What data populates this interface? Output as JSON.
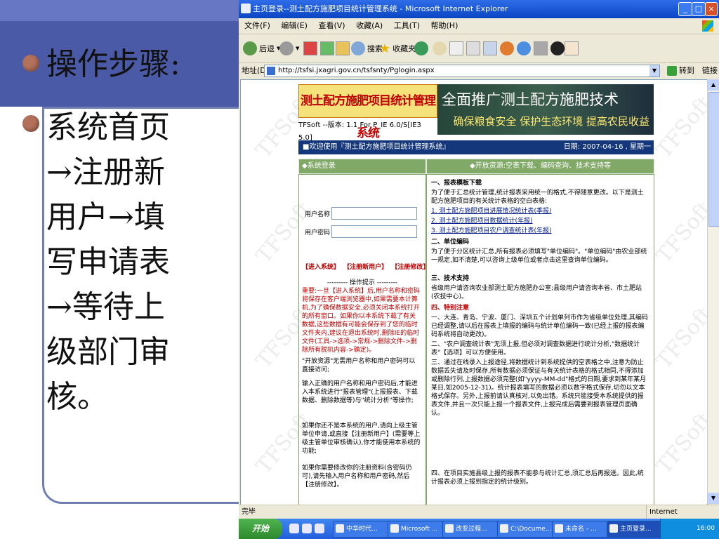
{
  "slide": {
    "heading": "操作步骤:",
    "body_lines": [
      "系统首页",
      "→注册新",
      "用户→填",
      "写申请表",
      "→等待上",
      "级部门审",
      "核。"
    ]
  },
  "window": {
    "title": "主页登录--测土配方施肥项目统计管理系统 - Microsoft Internet Explorer",
    "menu": [
      "文件(F)",
      "编辑(E)",
      "查看(V)",
      "收藏(A)",
      "工具(T)",
      "帮助(H)"
    ],
    "toolbar": {
      "back": "后退",
      "search": "搜索",
      "favorites": "收藏夹"
    },
    "address_label": "地址(D)",
    "address": "http://tsfsi.jxagri.gov.cn/tsfsnty/Pglogin.aspx",
    "go_label": "转到",
    "links_label": "链接 »"
  },
  "site": {
    "banner_title": "测土配方施肥项目统计管理系统",
    "banner_slogan1": "全面推广测土配方施肥技术",
    "banner_slogan2": "确保粮食安全 保护生态环境 提高农民收益",
    "version": "TFSoft --版本: 1.1 For P_IE 6.0/S[IE3 5.0]",
    "welcome": "■欢迎使用『测土配方施肥项目统计管理系统』",
    "date": "日期: 2007-04-16 , 星期一",
    "login_header": "◆系统登录",
    "resource_header": "◆开放资源:空表下载、编码查询、技术支持等",
    "username_label": "用户名称",
    "password_label": "用户密码",
    "links": [
      "【进入系统】",
      "【注册新用户】",
      "【注册修改】"
    ],
    "tips_heading": "--------- 操作提示 ---------",
    "tip_important": "重要:一旦【进入系统】后,用户名称和密码将保存在客户端浏览器中,如果需要本计算机,为了确保数据安全,必须关闭本系统打开的所有窗口。如果你以本系统下载了有关数据,这些数据有可能会保存到了您的临时文件夹内,建议在退出系统时,删除IE的临时文件(工具->选项->常规->删除文件->删除所有脱机内容->确定)。",
    "tip_open": "\"开放资源\"无需用户名称和用户密码可以直接访问;",
    "tip_enter": "输入正确的用户名称和用户密码后,才能进入本系统进行\"报表管理\"(上报报表、下载数据、删除数据等)与\"统计分析\"等操作;",
    "tip_register": "如果你还不是本系统的用户,请向上级主管单位申请,或直接【注册新用户】(需要等上级主管单位审核确认),你才能使用本系统的功能;",
    "tip_modify": "如果你需要修改你的注册资料(含密码仍可),请先输入用户名称和用户密码,然后【注册修改】。",
    "sec1_title": "一、报表模板下载",
    "sec1_text": "为了便于汇总统计管理,统计报表采用统一的格式,不得随意更改。以下是测土配方施肥项目的有关统计表格的空白表格:",
    "sec1_items": [
      "1. 测土配方施肥项目进展情况统计表(季报)",
      "2. 测土配方施肥项目数据统计(年报)",
      "3. 测土配方施肥项目农户调查统计表(年报)"
    ],
    "sec2_title": "二、单位编码",
    "sec2_text": "为了便于分区统计汇总,所有报表必须填写\"单位编码\"。\"单位编码\"由农业部统一规定,如不清楚,可以咨询上级单位或者点击这里查询单位编码。",
    "sec3_title": "三、技术支持",
    "sec3_text": "省级用户请咨询农业部测土配方施肥办公室;县级用户请咨询本省、市土肥站(农技中心)。",
    "sec4_title": "四、特别注意",
    "sec4_p1": "一、大连、青岛、宁波、厦门、深圳五个计划单列市作为省级单位处理,其编码已经调整,请以后在报表上填报的编码与统计单位编码一致(已经上报的报表编码系统将自动更改)。",
    "sec4_p2": "二、\"农户调查统计表\"无须上报,但必须对调查数据进行统计分析,\"数据统计表\"【选项】可以方便使用。",
    "sec4_p3": "三、通过在线录入上报途径,将数据统计到系统提供的空表格之中,注意为防止数据丢失请及时保存,所有数据必须保证与有关统计表格的格式相同,不得添加或删除行列,上报数据必须完整(如\"yyyy-MM-dd\"格式的日期,要求到某年某月某日,如2005-12-31)。统计报表填写的数据必须以数字格式保存,切勿以文本格式保存。另外,上报前请认真核对,以免出错。系统只能接受本系统提供的报表文件,并且一次只能上报一个报表文件,上报完成后需要到报表管理页面确认。",
    "sec4_p4": "四、在项目实施县级上报的报表不能参与统计汇总,须汇总后再报送。因此,统计报表必须上报到指定的统计级别。",
    "watermark": "TFSoft"
  },
  "status": {
    "left": "完毕",
    "right": "Internet"
  },
  "taskbar": {
    "start": "开始",
    "buttons": [
      "中华时代...",
      "Microsoft ...",
      "改变过程...",
      "C:\\Docume...",
      "未命名 - ...",
      "主页登录..."
    ],
    "time": "16:00"
  }
}
